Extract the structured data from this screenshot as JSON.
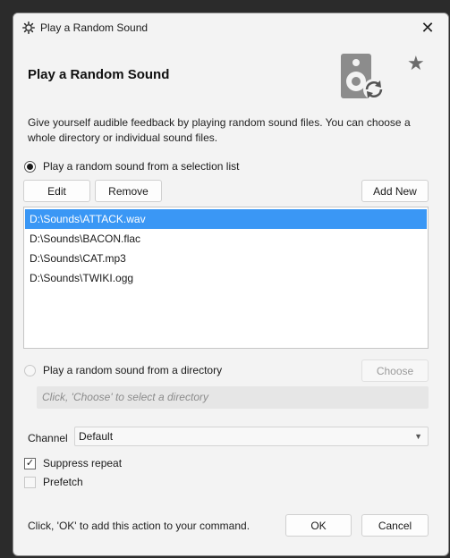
{
  "window": {
    "title": "Play a Random Sound"
  },
  "header": {
    "title": "Play a Random Sound",
    "description": "Give yourself audible feedback by playing random sound files.  You can choose a whole directory or individual sound files."
  },
  "selection_mode": {
    "list_option_label": "Play a random sound from a selection list",
    "list_option_selected": true,
    "directory_option_label": "Play a random sound from a directory",
    "directory_option_selected": false
  },
  "list_buttons": {
    "edit": "Edit",
    "remove": "Remove",
    "add_new": "Add New"
  },
  "files": [
    {
      "path": "D:\\Sounds\\ATTACK.wav",
      "selected": true
    },
    {
      "path": "D:\\Sounds\\BACON.flac",
      "selected": false
    },
    {
      "path": "D:\\Sounds\\CAT.mp3",
      "selected": false
    },
    {
      "path": "D:\\Sounds\\TWIKI.ogg",
      "selected": false
    }
  ],
  "directory": {
    "choose_label": "Choose",
    "placeholder": "Click, 'Choose' to select a directory"
  },
  "channel": {
    "label": "Channel",
    "value": "Default"
  },
  "options": {
    "suppress_repeat_label": "Suppress repeat",
    "suppress_repeat_checked": true,
    "prefetch_label": "Prefetch",
    "prefetch_checked": false
  },
  "footer": {
    "hint": "Click, 'OK' to add this action to your command.",
    "ok": "OK",
    "cancel": "Cancel"
  },
  "colors": {
    "selection": "#3a97f5",
    "window_bg": "#f3f3f3"
  },
  "icons": {
    "app": "gear-icon",
    "close": "close-icon",
    "header": "speaker-shuffle-icon",
    "star": "star-icon"
  }
}
